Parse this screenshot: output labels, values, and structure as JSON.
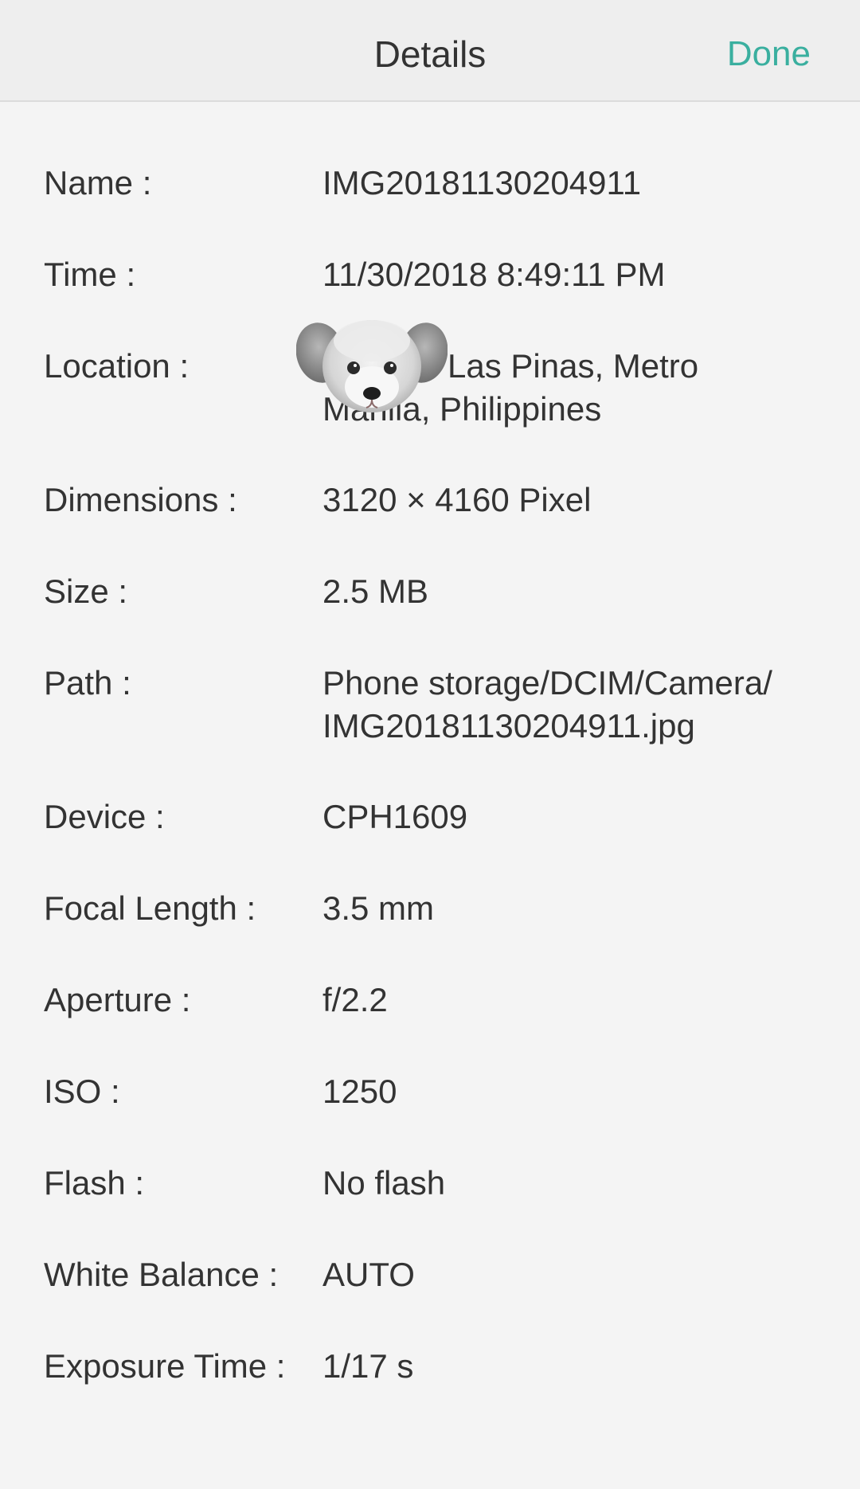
{
  "header": {
    "title": "Details",
    "done_label": "Done",
    "accent_color": "#3aaf9f"
  },
  "details": [
    {
      "label": "Name :",
      "value": "IMG20181130204911"
    },
    {
      "label": "Time :",
      "value": "11/30/2018 8:49:11 PM"
    },
    {
      "label": "Location :",
      "value": "Las Pinas, Metro Manila, Philippines"
    },
    {
      "label": "Dimensions :",
      "value": "3120 × 4160 Pixel"
    },
    {
      "label": "Size :",
      "value": "2.5 MB"
    },
    {
      "label": "Path :",
      "value": "Phone storage/DCIM/Camera/ IMG20181130204911.jpg"
    },
    {
      "label": "Device :",
      "value": "CPH1609"
    },
    {
      "label": "Focal Length :",
      "value": "3.5 mm"
    },
    {
      "label": "Aperture :",
      "value": "f/2.2"
    },
    {
      "label": "ISO :",
      "value": "1250"
    },
    {
      "label": "Flash :",
      "value": "No flash"
    },
    {
      "label": "White Balance :",
      "value": "AUTO"
    },
    {
      "label": "Exposure Time :",
      "value": "1/17 s"
    }
  ],
  "overlay": {
    "sticker": "dog-sticker"
  }
}
